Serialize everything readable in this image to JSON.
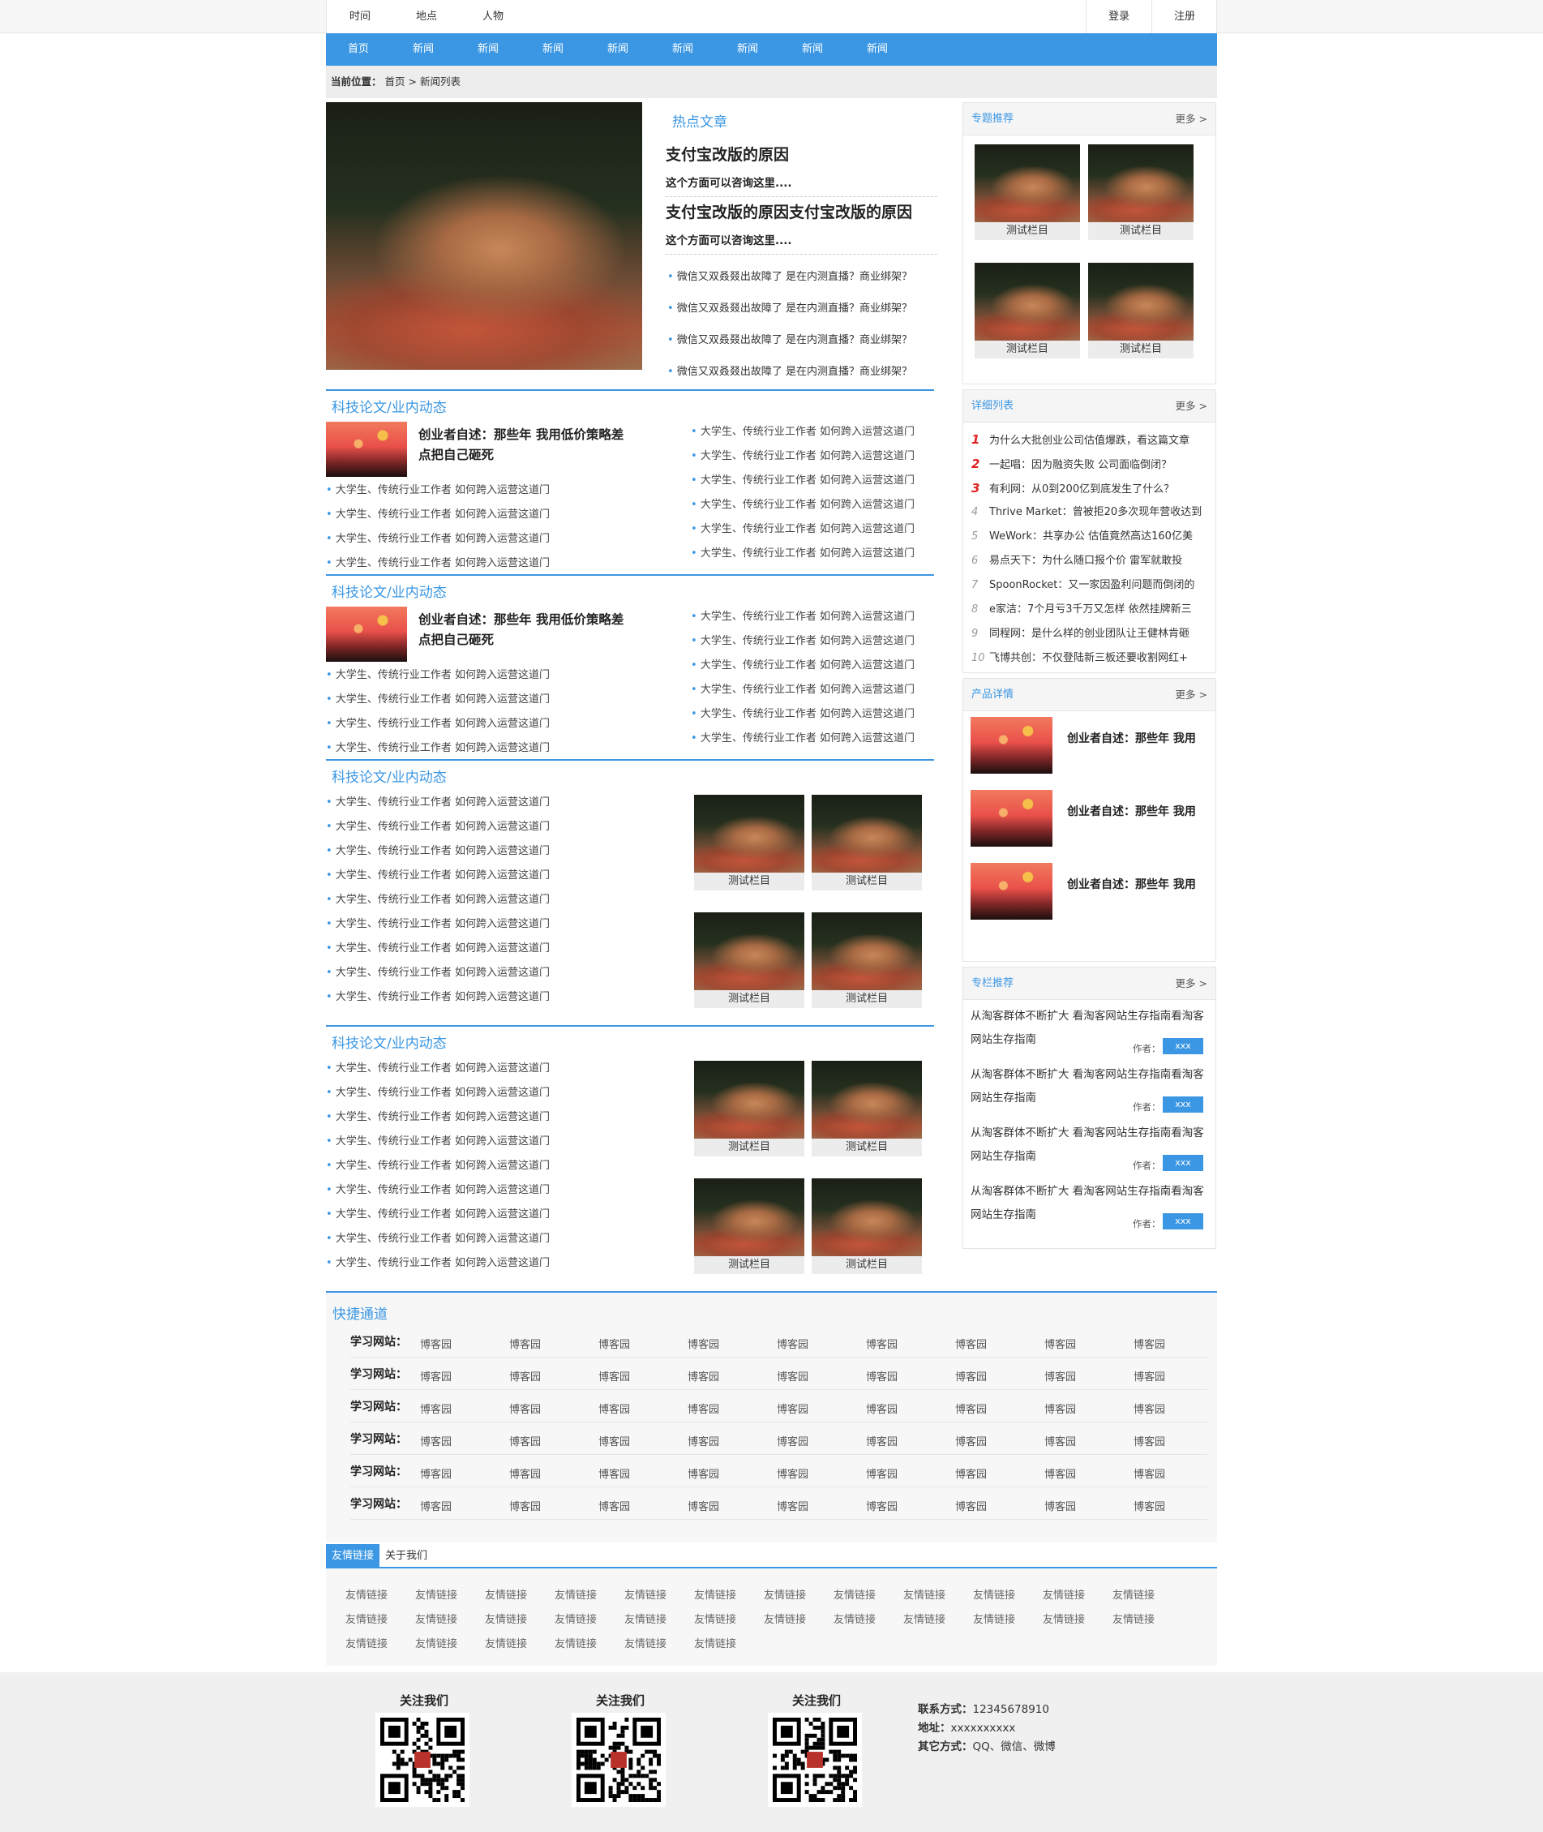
{
  "topbar": {
    "left": [
      "时间",
      "地点",
      "人物"
    ],
    "login": "登录",
    "register": "注册"
  },
  "nav": [
    "首页",
    "新闻",
    "新闻",
    "新闻",
    "新闻",
    "新闻",
    "新闻",
    "新闻",
    "新闻"
  ],
  "breadcrumb": {
    "label": "当前位置：",
    "home": "首页",
    "sep": ">",
    "current": "新闻列表"
  },
  "hot": {
    "title": "热点文章",
    "items": [
      {
        "heading": "支付宝改版的原因",
        "sub": "这个方面可以咨询这里...."
      },
      {
        "heading": "支付宝改版的原因支付宝改版的原因",
        "sub": "这个方面可以咨询这里...."
      }
    ],
    "list": [
      "微信又双叒叕出故障了 是在内测直播？商业绑架？",
      "微信又双叒叕出故障了 是在内测直播？商业绑架？",
      "微信又双叒叕出故障了 是在内测直播？商业绑架？",
      "微信又双叒叕出故障了 是在内测直播？商业绑架？"
    ]
  },
  "sections": [
    {
      "title": "科技论文/业内动态",
      "feature": "创业者自述：那些年 我用低价策略差点把自己砸死",
      "left": [
        "大学生、传统行业工作者 如何跨入运营这道门",
        "大学生、传统行业工作者 如何跨入运营这道门",
        "大学生、传统行业工作者 如何跨入运营这道门",
        "大学生、传统行业工作者 如何跨入运营这道门"
      ],
      "right": [
        "大学生、传统行业工作者 如何跨入运营这道门",
        "大学生、传统行业工作者 如何跨入运营这道门",
        "大学生、传统行业工作者 如何跨入运营这道门",
        "大学生、传统行业工作者 如何跨入运营这道门",
        "大学生、传统行业工作者 如何跨入运营这道门",
        "大学生、传统行业工作者 如何跨入运营这道门"
      ]
    },
    {
      "title": "科技论文/业内动态",
      "feature": "创业者自述：那些年 我用低价策略差点把自己砸死",
      "left": [
        "大学生、传统行业工作者 如何跨入运营这道门",
        "大学生、传统行业工作者 如何跨入运营这道门",
        "大学生、传统行业工作者 如何跨入运营这道门",
        "大学生、传统行业工作者 如何跨入运营这道门"
      ],
      "right": [
        "大学生、传统行业工作者 如何跨入运营这道门",
        "大学生、传统行业工作者 如何跨入运营这道门",
        "大学生、传统行业工作者 如何跨入运营这道门",
        "大学生、传统行业工作者 如何跨入运营这道门",
        "大学生、传统行业工作者 如何跨入运营这道门",
        "大学生、传统行业工作者 如何跨入运营这道门"
      ]
    },
    {
      "title": "科技论文/业内动态",
      "list": [
        "大学生、传统行业工作者 如何跨入运营这道门",
        "大学生、传统行业工作者 如何跨入运营这道门",
        "大学生、传统行业工作者 如何跨入运营这道门",
        "大学生、传统行业工作者 如何跨入运营这道门",
        "大学生、传统行业工作者 如何跨入运营这道门",
        "大学生、传统行业工作者 如何跨入运营这道门",
        "大学生、传统行业工作者 如何跨入运营这道门",
        "大学生、传统行业工作者 如何跨入运营这道门",
        "大学生、传统行业工作者 如何跨入运营这道门"
      ],
      "tiles": [
        "测试栏目",
        "测试栏目",
        "测试栏目",
        "测试栏目"
      ]
    },
    {
      "title": "科技论文/业内动态",
      "list": [
        "大学生、传统行业工作者 如何跨入运营这道门",
        "大学生、传统行业工作者 如何跨入运营这道门",
        "大学生、传统行业工作者 如何跨入运营这道门",
        "大学生、传统行业工作者 如何跨入运营这道门",
        "大学生、传统行业工作者 如何跨入运营这道门",
        "大学生、传统行业工作者 如何跨入运营这道门",
        "大学生、传统行业工作者 如何跨入运营这道门",
        "大学生、传统行业工作者 如何跨入运营这道门",
        "大学生、传统行业工作者 如何跨入运营这道门"
      ],
      "tiles": [
        "测试栏目",
        "测试栏目",
        "测试栏目",
        "测试栏目"
      ]
    }
  ],
  "right": {
    "topics": {
      "title": "专题推荐",
      "more": "更多 >",
      "tiles": [
        "测试栏目",
        "测试栏目",
        "测试栏目",
        "测试栏目"
      ]
    },
    "detail": {
      "title": "详细列表",
      "more": "更多 >",
      "items": [
        {
          "n": "1",
          "t": "为什么大批创业公司估值爆跌，看这篇文章"
        },
        {
          "n": "2",
          "t": "一起唱：因为融资失败 公司面临倒闭？"
        },
        {
          "n": "3",
          "t": "有利网：从0到200亿到底发生了什么？"
        },
        {
          "n": "4",
          "t": "Thrive Market：曾被拒20多次现年营收达到"
        },
        {
          "n": "5",
          "t": "WeWork：共享办公 估值竟然高达160亿美"
        },
        {
          "n": "6",
          "t": "易点天下：为什么随口报个价 雷军就敢投"
        },
        {
          "n": "7",
          "t": "SpoonRocket：又一家因盈利问题而倒闭的"
        },
        {
          "n": "8",
          "t": "e家洁：7个月亏3千万又怎样 依然挂牌新三"
        },
        {
          "n": "9",
          "t": "同程网：是什么样的创业团队让王健林肯砸"
        },
        {
          "n": "10",
          "t": "飞博共创：不仅登陆新三板还要收割网红+"
        }
      ]
    },
    "product": {
      "title": "产品详情",
      "more": "更多 >",
      "items": [
        "创业者自述：那些年 我用",
        "创业者自述：那些年 我用",
        "创业者自述：那些年 我用"
      ]
    },
    "column": {
      "title": "专栏推荐",
      "more": "更多 >",
      "author_label": "作者：",
      "items": [
        {
          "t": "从淘客群体不断扩大 看淘客网站生存指南看淘客网站生存指南",
          "author": "xxx"
        },
        {
          "t": "从淘客群体不断扩大 看淘客网站生存指南看淘客网站生存指南",
          "author": "xxx"
        },
        {
          "t": "从淘客群体不断扩大 看淘客网站生存指南看淘客网站生存指南",
          "author": "xxx"
        },
        {
          "t": "从淘客群体不断扩大 看淘客网站生存指南看淘客网站生存指南",
          "author": "xxx"
        }
      ]
    }
  },
  "quick": {
    "title": "快捷通道",
    "label": "学习网站：",
    "link": "博客园",
    "rows": 6,
    "cols": 9
  },
  "friend": {
    "tabs": [
      "友情链接",
      "关于我们"
    ],
    "link": "友情链接",
    "count": 30,
    "per_row": 12
  },
  "footer": {
    "follow": [
      "关注我们",
      "关注我们",
      "关注我们"
    ],
    "contact": [
      {
        "label": "联系方式：",
        "value": "12345678910"
      },
      {
        "label": "地址：",
        "value": "xxxxxxxxxx"
      },
      {
        "label": "其它方式：",
        "value": "QQ、微信、微博"
      }
    ]
  },
  "colors": {
    "accent": "#3b97e3",
    "rank_red": "#e02020"
  }
}
